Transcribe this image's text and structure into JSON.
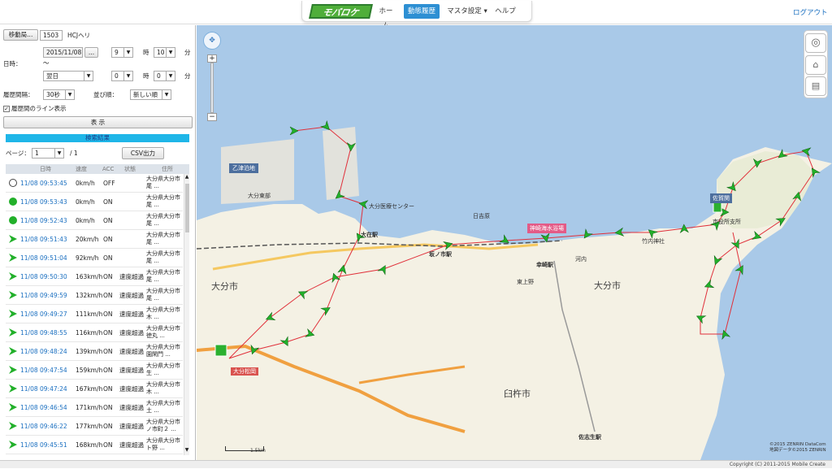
{
  "header": {
    "logo": "モバロケ",
    "nav": {
      "home": "ホーム",
      "history": "動態履歴",
      "master": "マスタ設定",
      "help": "ヘルプ"
    },
    "logout": "ログアウト"
  },
  "form": {
    "unit_button": "移動局...",
    "unit_id": "1503",
    "unit_name": "HCJヘリ",
    "datetime_label": "日時：",
    "date_from": "2015/11/08",
    "date_btn": "...",
    "tilde": "～",
    "hour_from": "9",
    "minute_from": "10",
    "date_to": "翌日",
    "hour_to": "0",
    "minute_to": "0",
    "hour_unit": "時",
    "minute_unit": "分",
    "interval_label": "履歴間隔：",
    "interval_value": "30秒",
    "order_label": "並び順：",
    "order_value": "新しい順",
    "line_checkbox_label": "履歴間のライン表示",
    "line_checkbox_checked": true,
    "show_button": "表 示"
  },
  "results": {
    "title": "検索結果",
    "page_label": "ページ：",
    "page_value": "1",
    "page_total": "/ 1",
    "csv_button": "CSV出力",
    "columns": [
      "日時",
      "速度",
      "ACC",
      "状態",
      "住所"
    ],
    "rows": [
      {
        "icon": "clock-icon",
        "time": "11/08 09:53:45",
        "speed": "0km/h",
        "acc": "OFF",
        "state": "",
        "addr": "大分県大分市\n尾 ..."
      },
      {
        "icon": "stop-icon",
        "time": "11/08 09:53:43",
        "speed": "0km/h",
        "acc": "ON",
        "state": "",
        "addr": "大分県大分市\n尾 ..."
      },
      {
        "icon": "stop-icon",
        "time": "11/08 09:52:43",
        "speed": "0km/h",
        "acc": "ON",
        "state": "",
        "addr": "大分県大分市\n尾 ..."
      },
      {
        "icon": "arrow-icon",
        "time": "11/08 09:51:43",
        "speed": "20km/h",
        "acc": "ON",
        "state": "",
        "addr": "大分県大分市\n尾 ..."
      },
      {
        "icon": "arrow-icon",
        "time": "11/08 09:51:04",
        "speed": "92km/h",
        "acc": "ON",
        "state": "",
        "addr": "大分県大分市\n尾 ..."
      },
      {
        "icon": "arrow-icon",
        "time": "11/08 09:50:30",
        "speed": "163km/h",
        "acc": "ON",
        "state": "速度超過",
        "addr": "大分県大分市\n尾 ..."
      },
      {
        "icon": "arrow-icon",
        "time": "11/08 09:49:59",
        "speed": "132km/h",
        "acc": "ON",
        "state": "速度超過",
        "addr": "大分県大分市\n尾 ..."
      },
      {
        "icon": "arrow-icon",
        "time": "11/08 09:49:27",
        "speed": "111km/h",
        "acc": "ON",
        "state": "速度超過",
        "addr": "大分県大分市\n木 ..."
      },
      {
        "icon": "arrow-icon",
        "time": "11/08 09:48:55",
        "speed": "116km/h",
        "acc": "ON",
        "state": "速度超過",
        "addr": "大分県大分市\n徳丸 ..."
      },
      {
        "icon": "arrow-icon",
        "time": "11/08 09:48:24",
        "speed": "139km/h",
        "acc": "ON",
        "state": "速度超過",
        "addr": "大分県大分市\n園閑門 ..."
      },
      {
        "icon": "arrow-icon",
        "time": "11/08 09:47:54",
        "speed": "159km/h",
        "acc": "ON",
        "state": "速度超過",
        "addr": "大分県大分市\n生 ..."
      },
      {
        "icon": "arrow-icon",
        "time": "11/08 09:47:24",
        "speed": "167km/h",
        "acc": "ON",
        "state": "速度超過",
        "addr": "大分県大分市\n木 ..."
      },
      {
        "icon": "arrow-icon",
        "time": "11/08 09:46:54",
        "speed": "171km/h",
        "acc": "ON",
        "state": "速度超過",
        "addr": "大分県大分市\n土 ..."
      },
      {
        "icon": "arrow-icon",
        "time": "11/08 09:46:22",
        "speed": "177km/h",
        "acc": "ON",
        "state": "速度超過",
        "addr": "大分県大分市\nノ市町２ ..."
      },
      {
        "icon": "arrow-icon",
        "time": "11/08 09:45:51",
        "speed": "168km/h",
        "acc": "ON",
        "state": "速度超過",
        "addr": "大分県大分市\nト野 ..."
      }
    ]
  },
  "map": {
    "labels": {
      "otsu": "乙津泊地",
      "oita_city": "大分市",
      "oita_city2": "大分市",
      "usuki": "臼杵市",
      "ozai": "大在駅",
      "sakanoichi": "坂ノ市駅",
      "kozaki": "幸崎駅",
      "saganoseki": "佐賀関",
      "saiki": "佐志生駅",
      "saganoseki_office": "市役所支所",
      "aquarium": "神崎海水浴場",
      "port": "大分医療センター",
      "hita": "日吉原",
      "misaki": "竹内神社",
      "stadium": "大分東部",
      "osai2": "大分東部",
      "kawauchi": "河内",
      "kitahama": "大分松岡",
      "kozaki_line": "東上野"
    },
    "attribution": "©2015 ZENRIN DataCom\n地図データ©2015 ZENRIN",
    "scale": "1.5km"
  },
  "footer": {
    "copyright": "Copyright (C) 2011-2015 Mobile Create"
  },
  "colors": {
    "accent": "#2d8fd3",
    "results_bar": "#1fb6e8",
    "link": "#1a6fc0",
    "marker": "#22b02a",
    "route": "#e0303a",
    "sea": "#a9c9e8"
  }
}
